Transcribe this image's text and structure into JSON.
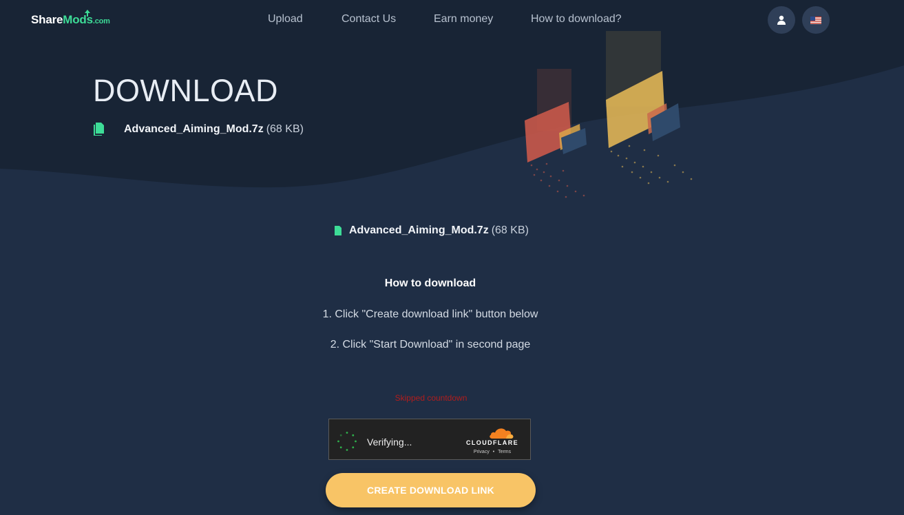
{
  "brand": {
    "share": "Share",
    "mods": "Mods",
    "dotcom": ".com"
  },
  "nav": [
    {
      "label": "Upload"
    },
    {
      "label": "Contact Us"
    },
    {
      "label": "Earn money"
    },
    {
      "label": "How to download?"
    }
  ],
  "icons": {
    "user": "user-icon",
    "language": "us-flag-icon",
    "file": "file-icon",
    "spinner": "spinner-icon",
    "cloud": "cloudflare-cloud-icon"
  },
  "hero": {
    "title": "DOWNLOAD",
    "file_name": "Advanced_Aiming_Mod.7z",
    "file_size": "(68 KB)"
  },
  "main": {
    "file_name": "Advanced_Aiming_Mod.7z",
    "file_size": "(68 KB)",
    "howto_title": "How to download",
    "step1": "1. Click \"Create download link\" button below",
    "step2": "2. Click \"Start Download\" in second page",
    "skipped": "Skipped countdown"
  },
  "captcha": {
    "status": "Verifying...",
    "brand": "CLOUDFLARE",
    "privacy": "Privacy",
    "separator": "•",
    "terms": "Terms"
  },
  "cta": {
    "label": "CREATE DOWNLOAD LINK"
  },
  "colors": {
    "page_bg": "#1f2e45",
    "hero_bg": "#182435",
    "accent_green": "#3ddc97",
    "cta_bg": "#f8c466",
    "warning_red": "#b11d1d",
    "cloudflare_orange": "#f48120"
  }
}
